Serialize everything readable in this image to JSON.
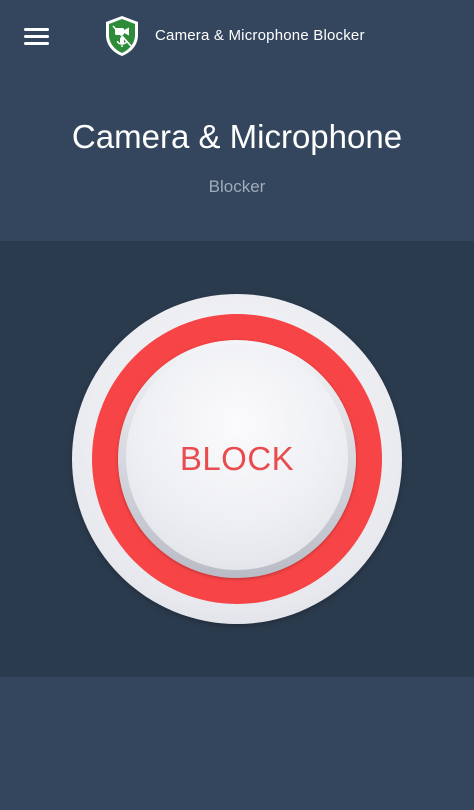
{
  "app_bar": {
    "title": "Camera & Microphone Blocker",
    "menu_icon": "hamburger-menu-icon",
    "logo_icon": "shield-logo-icon"
  },
  "header": {
    "title": "Camera & Microphone",
    "subtitle": "Blocker"
  },
  "main": {
    "block_button_label": "BLOCK"
  },
  "colors": {
    "background": "#34465d",
    "panel": "#2b3b4e",
    "accent_red": "#f74446",
    "label_red": "#e94c4f",
    "logo_green": "#2e8b3a"
  }
}
